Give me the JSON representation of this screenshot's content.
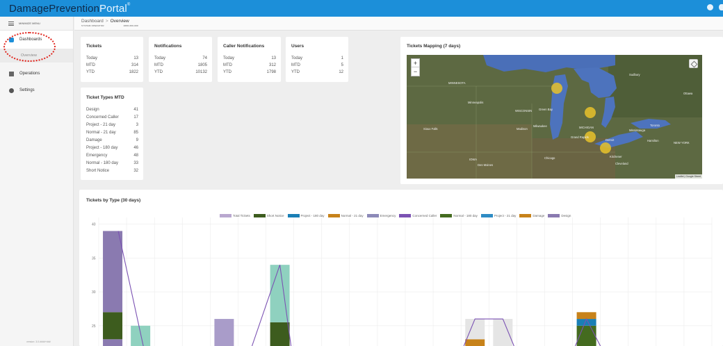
{
  "app": {
    "brand_part1": "DamagePrevention",
    "brand_part2": "Portal",
    "brand_mark": "®"
  },
  "sidebar": {
    "menu_label": "MINIMIZE MENU",
    "items": [
      {
        "label": "Dashboards",
        "icon": "dashboard-icon"
      },
      {
        "label": "Overview"
      },
      {
        "label": "Operations",
        "icon": "grid-icon"
      },
      {
        "label": "Settings",
        "icon": "gear-icon"
      }
    ],
    "version": "version: 3.0.####+###"
  },
  "breadcrumb": {
    "parent": "Dashboard",
    "separator": ">",
    "current": "Overview",
    "sub1": "SYSTEM OPERATOR",
    "sub2": "####-###-###"
  },
  "stats": [
    {
      "title": "Tickets",
      "rows": [
        {
          "label": "Today",
          "value": "13"
        },
        {
          "label": "MTD",
          "value": "314"
        },
        {
          "label": "YTD",
          "value": "1822"
        }
      ]
    },
    {
      "title": "Notifications",
      "rows": [
        {
          "label": "Today",
          "value": "74"
        },
        {
          "label": "MTD",
          "value": "1805"
        },
        {
          "label": "YTD",
          "value": "10132"
        }
      ]
    },
    {
      "title": "Caller Notifications",
      "rows": [
        {
          "label": "Today",
          "value": "13"
        },
        {
          "label": "MTD",
          "value": "312"
        },
        {
          "label": "YTD",
          "value": "1798"
        }
      ]
    },
    {
      "title": "Users",
      "rows": [
        {
          "label": "Today",
          "value": "1"
        },
        {
          "label": "MTD",
          "value": "5"
        },
        {
          "label": "YTD",
          "value": "12"
        }
      ]
    }
  ],
  "ticket_types": {
    "title": "Ticket Types MTD",
    "rows": [
      {
        "label": "Design",
        "value": "41"
      },
      {
        "label": "Concerned Caller",
        "value": "17"
      },
      {
        "label": "Project - 21 day",
        "value": "3"
      },
      {
        "label": "Normal - 21 day",
        "value": "85"
      },
      {
        "label": "Damage",
        "value": "9"
      },
      {
        "label": "Project - 180 day",
        "value": "46"
      },
      {
        "label": "Emergency",
        "value": "48"
      },
      {
        "label": "Normal - 180 day",
        "value": "33"
      },
      {
        "label": "Short Notice",
        "value": "32"
      }
    ]
  },
  "map": {
    "title": "Tickets Mapping (7 days)",
    "zoom_in": "+",
    "zoom_out": "−",
    "attribution": "Leaflet | Google Street",
    "labels": [
      "MINNESOTA",
      "Minneapolis",
      "WISCONSIN",
      "Green Bay",
      "Milwaukee",
      "Madison",
      "Chicago",
      "IOWA",
      "MICHIGAN",
      "Grand Rapids",
      "Detroit",
      "Cleveland",
      "Toronto",
      "Mississauga",
      "Hamilton",
      "Ottawa",
      "NEW YORK",
      "Sioux Falls",
      "Des Moines",
      "Sudbury",
      "Kitchener"
    ],
    "markers": 4,
    "marker_color": "#e8c22a"
  },
  "colors": {
    "topbar": "#1c8fd9",
    "annotation": "#e0231b"
  },
  "chart": {
    "title": "Tickets by Type (30 days)"
  },
  "chart_data": {
    "type": "bar",
    "title": "Tickets by Type (30 days)",
    "xlabel": "",
    "ylabel": "",
    "ylim": [
      22,
      41
    ],
    "yticks": [
      "40",
      "35",
      "30",
      "25"
    ],
    "legend_position": "top",
    "legend": [
      {
        "name": "Total Tickets",
        "color": "#b9a8cf",
        "kind": "line"
      },
      {
        "name": "Short Notice",
        "color": "#3d5c1e",
        "kind": "bar"
      },
      {
        "name": "Project - 180 day",
        "color": "#1a7fb5",
        "kind": "bar"
      },
      {
        "name": "Normal - 21 day",
        "color": "#c7821a",
        "kind": "bar"
      },
      {
        "name": "Emergency",
        "color": "#8d8ab8",
        "kind": "bar"
      },
      {
        "name": "Concerned Caller",
        "color": "#7b52b3",
        "kind": "bar"
      },
      {
        "name": "Normal - 180 day",
        "color": "#446b1f",
        "kind": "bar"
      },
      {
        "name": "Project - 21 day",
        "color": "#2e8cc4",
        "kind": "bar"
      },
      {
        "name": "Damage",
        "color": "#c7821a",
        "kind": "bar"
      },
      {
        "name": "Design",
        "color": "#8a7ab0",
        "kind": "bar"
      }
    ],
    "stacks": [
      {
        "x": 0,
        "segments": [
          {
            "color": "#8a7ab0",
            "from": 22,
            "to": 23
          },
          {
            "color": "#3d5c1e",
            "from": 23,
            "to": 27
          },
          {
            "color": "#8a7ab0",
            "from": 27,
            "to": 39
          }
        ]
      },
      {
        "x": 1,
        "segments": [
          {
            "color": "#8fd1bf",
            "from": 22,
            "to": 25
          }
        ]
      },
      {
        "x": 4,
        "segments": [
          {
            "color": "#a99cc9",
            "from": 22,
            "to": 26
          }
        ]
      },
      {
        "x": 6,
        "segments": [
          {
            "color": "#3d5c1e",
            "from": 22,
            "to": 25.5
          },
          {
            "color": "#8fd1bf",
            "from": 25.5,
            "to": 34
          }
        ]
      },
      {
        "x": 13,
        "segments": [
          {
            "color": "#c7821a",
            "from": 22,
            "to": 23
          },
          {
            "color": "#e5e5e5",
            "from": 23,
            "to": 26
          }
        ]
      },
      {
        "x": 14,
        "segments": [
          {
            "color": "#e5e5e5",
            "from": 22,
            "to": 26
          }
        ]
      },
      {
        "x": 17,
        "segments": [
          {
            "color": "#446b1f",
            "from": 22,
            "to": 25
          },
          {
            "color": "#1a7fb5",
            "from": 25,
            "to": 26
          },
          {
            "color": "#c7821a",
            "from": 26,
            "to": 27
          }
        ]
      }
    ],
    "lines": [
      {
        "color": "#7b52b3",
        "points": [
          [
            0.2,
            39
          ],
          [
            1.1,
            22
          ]
        ]
      },
      {
        "color": "#7b52b3",
        "points": [
          [
            5,
            22
          ],
          [
            6,
            34
          ],
          [
            6.4,
            22
          ]
        ]
      },
      {
        "color": "#7b52b3",
        "points": [
          [
            12.6,
            22
          ],
          [
            13,
            26
          ],
          [
            14,
            26
          ],
          [
            14.4,
            22
          ]
        ]
      },
      {
        "color": "#7b52b3",
        "points": [
          [
            16.6,
            22
          ],
          [
            17,
            26
          ],
          [
            17.5,
            22
          ]
        ]
      }
    ]
  }
}
